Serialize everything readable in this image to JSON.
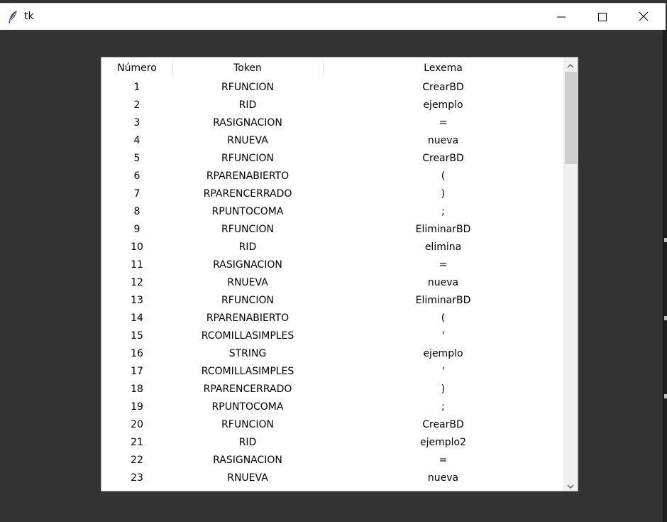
{
  "window": {
    "title": "tk",
    "icon": "feather-icon",
    "controls": [
      "minimize-icon",
      "maximize-icon",
      "close-icon"
    ]
  },
  "table": {
    "headers": [
      "Número",
      "Token",
      "Lexema"
    ],
    "rows": [
      {
        "num": "1",
        "token": "RFUNCION",
        "lexema": "CrearBD"
      },
      {
        "num": "2",
        "token": "RID",
        "lexema": "ejemplo"
      },
      {
        "num": "3",
        "token": "RASIGNACION",
        "lexema": "="
      },
      {
        "num": "4",
        "token": "RNUEVA",
        "lexema": "nueva"
      },
      {
        "num": "5",
        "token": "RFUNCION",
        "lexema": "CrearBD"
      },
      {
        "num": "6",
        "token": "RPARENABIERTO",
        "lexema": "("
      },
      {
        "num": "7",
        "token": "RPARENCERRADO",
        "lexema": ")"
      },
      {
        "num": "8",
        "token": "RPUNTOCOMA",
        "lexema": ";"
      },
      {
        "num": "9",
        "token": "RFUNCION",
        "lexema": "EliminarBD"
      },
      {
        "num": "10",
        "token": "RID",
        "lexema": "elimina"
      },
      {
        "num": "11",
        "token": "RASIGNACION",
        "lexema": "="
      },
      {
        "num": "12",
        "token": "RNUEVA",
        "lexema": "nueva"
      },
      {
        "num": "13",
        "token": "RFUNCION",
        "lexema": "EliminarBD"
      },
      {
        "num": "14",
        "token": "RPARENABIERTO",
        "lexema": "("
      },
      {
        "num": "15",
        "token": "RCOMILLASIMPLES",
        "lexema": "'"
      },
      {
        "num": "16",
        "token": "STRING",
        "lexema": "ejemplo"
      },
      {
        "num": "17",
        "token": "RCOMILLASIMPLES",
        "lexema": "'"
      },
      {
        "num": "18",
        "token": "RPARENCERRADO",
        "lexema": ")"
      },
      {
        "num": "19",
        "token": "RPUNTOCOMA",
        "lexema": ";"
      },
      {
        "num": "20",
        "token": "RFUNCION",
        "lexema": "CrearBD"
      },
      {
        "num": "21",
        "token": "RID",
        "lexema": "ejemplo2"
      },
      {
        "num": "22",
        "token": "RASIGNACION",
        "lexema": "="
      },
      {
        "num": "23",
        "token": "RNUEVA",
        "lexema": "nueva"
      }
    ]
  },
  "scrollbar": {
    "up_icon": "chevron-up-icon",
    "down_icon": "chevron-down-icon"
  },
  "colors": {
    "window_bg": "#333333",
    "titlebar_bg": "#ffffff",
    "table_bg": "#ffffff",
    "scroll_thumb": "#cdcdcd"
  }
}
